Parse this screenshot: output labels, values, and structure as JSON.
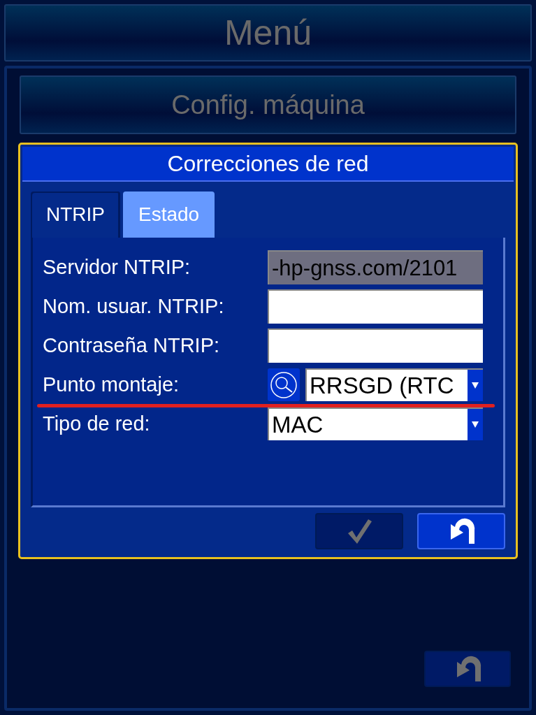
{
  "header": {
    "title": "Menú",
    "disabled": true
  },
  "section": {
    "title": "Config. máquina",
    "disabled": true
  },
  "dialog": {
    "title": "Correcciones de red",
    "tabs": [
      {
        "label": "NTRIP",
        "selected": true
      },
      {
        "label": "Estado",
        "selected": false
      }
    ],
    "fields": [
      {
        "kind": "text",
        "label": "Servidor NTRIP:",
        "value": "-hp-gnss.com/2101",
        "disabled": true,
        "underlined": false
      },
      {
        "kind": "text",
        "label": "Nom. usuar. NTRIP:",
        "disabled": false,
        "underlined": false
      },
      {
        "kind": "text",
        "label": "Contraseña NTRIP:",
        "disabled": false,
        "underlined": false
      },
      {
        "kind": "search-dropdown",
        "label": "Punto montaje:",
        "value": "RRSGD (RTC",
        "underlined": true
      },
      {
        "kind": "dropdown",
        "label": "Tipo de red:",
        "value": "MAC",
        "underlined": false
      }
    ],
    "buttons": [
      {
        "kind": "confirm",
        "disabled": true
      },
      {
        "kind": "back",
        "disabled": false
      }
    ]
  },
  "footer": {
    "buttons": [
      {
        "kind": "back",
        "disabled": true
      }
    ]
  }
}
